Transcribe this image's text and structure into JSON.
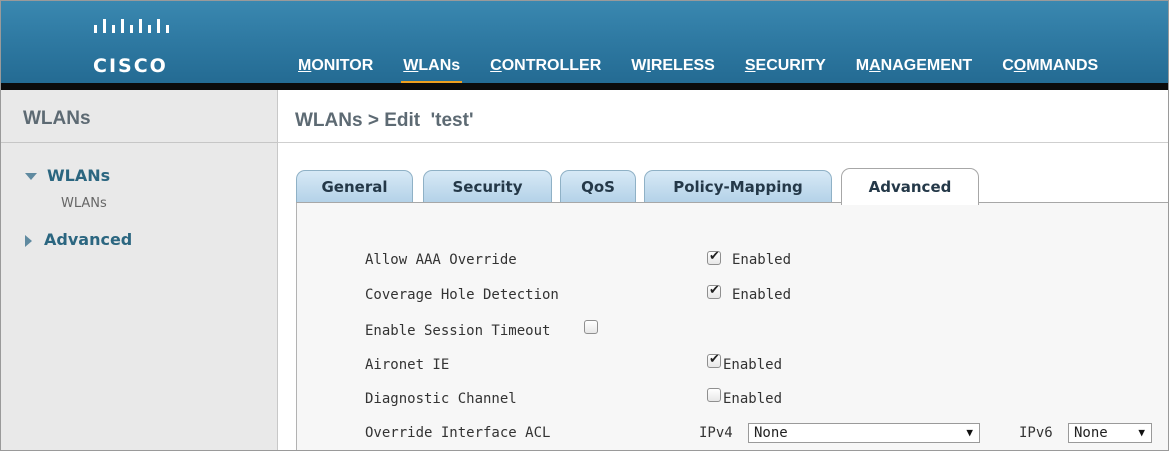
{
  "brand": {
    "name": "CISCO",
    "logo_icon": "cisco-bridge-icon"
  },
  "nav": {
    "items": [
      {
        "label": "MONITOR",
        "underline_index": 0
      },
      {
        "label": "WLANs",
        "underline_index": 0,
        "active": true
      },
      {
        "label": "CONTROLLER",
        "underline_index": 0
      },
      {
        "label": "WIRELESS",
        "underline_index": 1
      },
      {
        "label": "SECURITY",
        "underline_index": 0
      },
      {
        "label": "MANAGEMENT",
        "underline_index": 1
      },
      {
        "label": "COMMANDS",
        "underline_index": 1
      }
    ]
  },
  "sidebar": {
    "title": "WLANs",
    "groups": [
      {
        "label": "WLANs",
        "expanded": true,
        "children": [
          "WLANs"
        ]
      },
      {
        "label": "Advanced",
        "expanded": false
      }
    ]
  },
  "main": {
    "title": "WLANs > Edit  'test'",
    "tabs": [
      {
        "label": "General"
      },
      {
        "label": "Security"
      },
      {
        "label": "QoS"
      },
      {
        "label": "Policy-Mapping"
      },
      {
        "label": "Advanced",
        "active": true
      }
    ],
    "rows": [
      {
        "label": "Allow AAA Override",
        "checked": true,
        "value_label": "Enabled"
      },
      {
        "label": "Coverage Hole Detection",
        "checked": true,
        "value_label": "Enabled"
      },
      {
        "label": "Enable Session Timeout",
        "checked": false
      },
      {
        "label": "Aironet IE",
        "checked": true,
        "value_label": "Enabled"
      },
      {
        "label": "Diagnostic Channel",
        "checked": false,
        "value_label": "Enabled"
      },
      {
        "label": "Override Interface ACL",
        "ipv4_label": "IPv4",
        "ipv4_value": "None",
        "ipv6_label": "IPv6",
        "ipv6_value": "None"
      }
    ]
  },
  "colors": {
    "header": "#2f7aa3",
    "active_nav": "#f0a020",
    "tab": "#c6def0"
  }
}
